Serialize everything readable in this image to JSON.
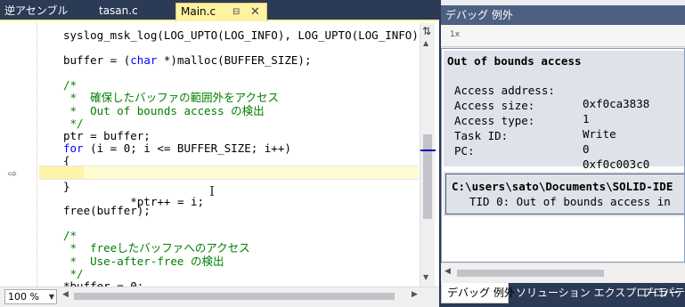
{
  "editor": {
    "tabs": [
      {
        "label": "逆アセンブル"
      },
      {
        "label": "tasan.c"
      },
      {
        "label": "Main.c"
      }
    ],
    "active_tab_pin_icon": "pin-icon",
    "active_tab_close_icon": "✕",
    "zoom": "100 %"
  },
  "code": {
    "l1": "syslog_msk_log(LOG_UPTO(LOG_INFO), LOG_UPTO(LOG_INFO));",
    "l2a": "buffer = (",
    "l2b": "char",
    "l2c": " *)malloc(BUFFER_SIZE);",
    "c1": "/*",
    "c2": " *  確保したバッファの範囲外をアクセス",
    "c3": " *  Out of bounds access の検出",
    "c4": " */",
    "l3": "ptr = buffer;",
    "l4a": "for",
    "l4b": " (i = 0; i <= BUFFER_SIZE; i++)",
    "l5": "{",
    "l6": "    *ptr++ = i;",
    "l7": "}",
    "l8": "free(buffer);",
    "c5": "/*",
    "c6": " *  freeしたバッファへのアクセス",
    "c7": " *  Use-after-free の検出",
    "c8": " */",
    "l9": "*buffer = 0;"
  },
  "debug": {
    "title": "デバッグ 例外",
    "toolbar_icon": "1x",
    "exception_title": "Out of bounds access",
    "rows": [
      {
        "key": "Access address:",
        "value": "0xf0ca3838"
      },
      {
        "key": "Access size:",
        "value": "1"
      },
      {
        "key": "Access type:",
        "value": "Write"
      },
      {
        "key": "Task ID:",
        "value": "0"
      },
      {
        "key": "PC:",
        "value": "0xf0c003c0"
      }
    ],
    "source_path": "C:\\users\\sato\\Documents\\SOLID-IDE",
    "source_detail": "TID 0: Out of bounds access in"
  },
  "bottom_tabs": [
    {
      "label": "デバッグ 例外"
    },
    {
      "label": "ソリューション エクスプローラー"
    },
    {
      "label": "プロパティ"
    }
  ]
}
